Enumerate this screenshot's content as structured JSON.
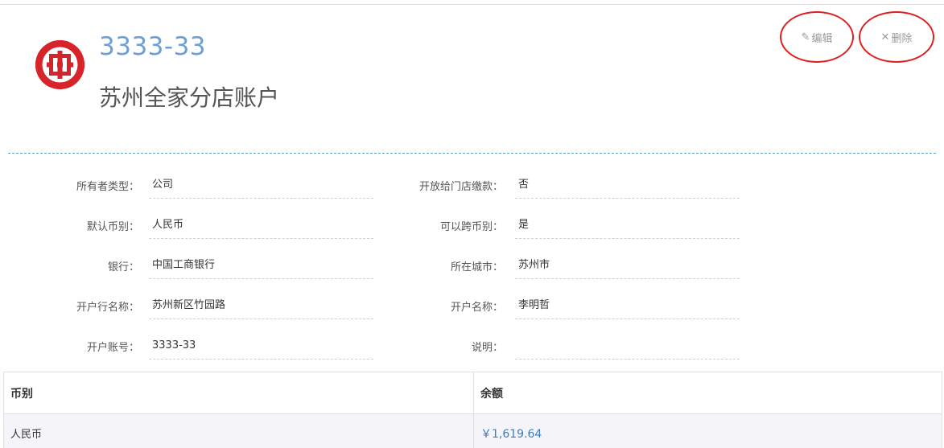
{
  "header": {
    "account_number": "3333-33",
    "account_name": "苏州全家分店账户",
    "edit_label": "编辑",
    "delete_label": "删除",
    "edit_icon": "pencil-icon",
    "delete_icon": "close-icon"
  },
  "details": {
    "owner_type": {
      "label": "所有者类型：",
      "value": "公司"
    },
    "default_currency": {
      "label": "默认币别：",
      "value": "人民币"
    },
    "bank": {
      "label": "银行：",
      "value": "中国工商银行"
    },
    "branch_name": {
      "label": "开户行名称：",
      "value": "苏州新区竹园路"
    },
    "account_no": {
      "label": "开户账号：",
      "value": "3333-33"
    },
    "open_to_store": {
      "label": "开放给门店缴款：",
      "value": "否"
    },
    "cross_currency": {
      "label": "可以跨币别：",
      "value": "是"
    },
    "city": {
      "label": "所在城市：",
      "value": "苏州市"
    },
    "holder_name": {
      "label": "开户名称：",
      "value": "李明哲"
    },
    "remark": {
      "label": "说明：",
      "value": ""
    }
  },
  "balance_table": {
    "headers": [
      "币别",
      "余额"
    ],
    "rows": [
      {
        "currency": "人民币",
        "balance": "￥1,619.64"
      }
    ]
  },
  "colors": {
    "account_number": "#6a9fd8",
    "logo": "#d7232a",
    "highlight_circle": "#e02020",
    "amount": "#3a7dbf"
  }
}
